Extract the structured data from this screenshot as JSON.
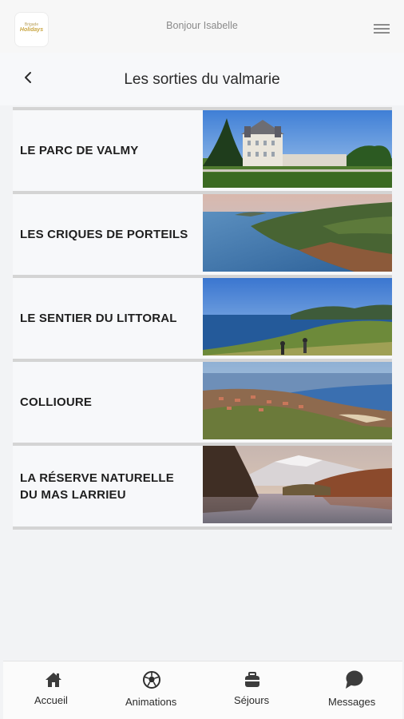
{
  "header": {
    "greeting": "Bonjour Isabelle",
    "logo_text": [
      "Brigade",
      "Holidays",
      "·"
    ]
  },
  "page": {
    "title": "Les sorties du valmarie"
  },
  "outings": [
    {
      "line1": "LE PARC DE VALMY",
      "line2": "",
      "photo": "chateau-photo"
    },
    {
      "line1": "LES CRIQUES DE PORTEILS",
      "line2": "",
      "photo": "coast-cliffs-photo"
    },
    {
      "line1": "LE SENTIER DU LITTORAL",
      "line2": "",
      "photo": "coastal-path-photo"
    },
    {
      "line1": "COLLIOURE",
      "line2": "",
      "photo": "town-aerial-photo"
    },
    {
      "line1": "LA RÉSERVE NATURELLE",
      "line2": "DU MAS LARRIEU",
      "photo": "river-mountain-photo"
    }
  ],
  "nav": [
    {
      "label": "Accueil",
      "icon": "home-icon"
    },
    {
      "label": "Animations",
      "icon": "soccer-ball-icon"
    },
    {
      "label": "Séjours",
      "icon": "suitcase-icon"
    },
    {
      "label": "Messages",
      "icon": "chat-bubble-icon"
    }
  ],
  "colors": {
    "background": "#f2f3f5",
    "card": "#f7f8fa",
    "divider": "#d4d4d4",
    "text": "#1f1f1f",
    "muted": "#8a8a8a"
  }
}
